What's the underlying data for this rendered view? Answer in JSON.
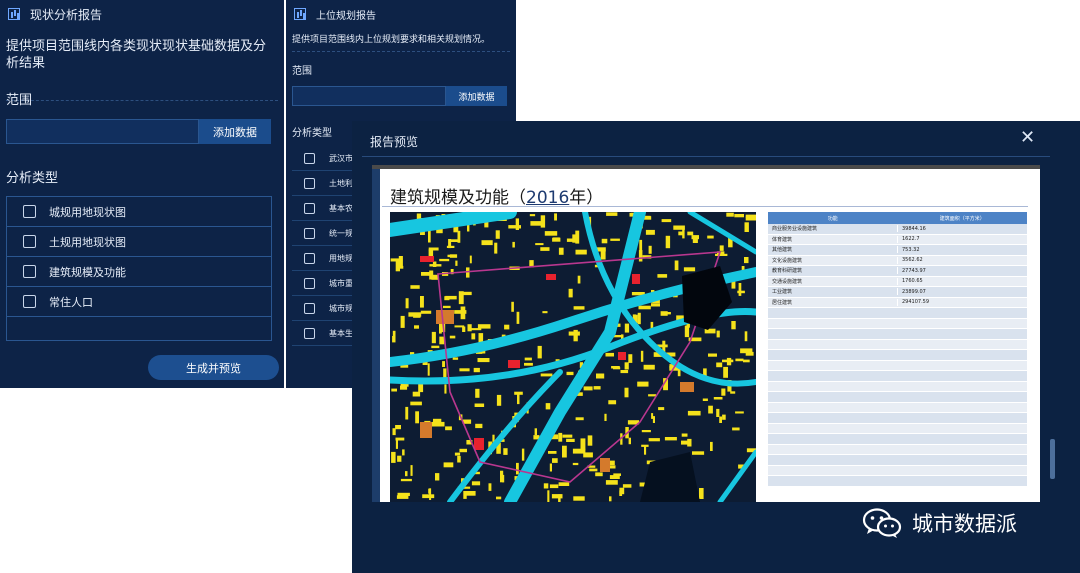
{
  "panel_a": {
    "title": "现状分析报告",
    "description": "提供项目范围线内各类现状现状基础数据及分析结果",
    "range_label": "范围",
    "add_data_label": "添加数据",
    "type_label": "分析类型",
    "types": [
      "城规用地现状图",
      "土规用地现状图",
      "建筑规模及功能",
      "常住人口"
    ],
    "generate_label": "生成并预览"
  },
  "panel_b": {
    "title": "上位规划报告",
    "description": "提供项目范围线内上位规划要求和相关规划情况。",
    "range_label": "范围",
    "add_data_label": "添加数据",
    "type_label": "分析类型",
    "types": [
      "武汉市",
      "土地利",
      "基本农",
      "统一规",
      "用地规",
      "城市重",
      "城市规",
      "基本生"
    ]
  },
  "modal": {
    "title": "报告预览",
    "close_icon": "close-icon",
    "doc_title_prefix": "建筑规模及功能（",
    "doc_title_year": "2016",
    "doc_title_suffix": "年）",
    "table": {
      "headers": [
        "功能",
        "建筑面积（平方米）"
      ],
      "rows": [
        [
          "商业服务业设施建筑",
          "39844.16"
        ],
        [
          "体育建筑",
          "1622.7"
        ],
        [
          "其他建筑",
          "753.32"
        ],
        [
          "文化设施建筑",
          "3562.62"
        ],
        [
          "教育科研建筑",
          "27743.97"
        ],
        [
          "交通设施建筑",
          "1760.65"
        ],
        [
          "工业建筑",
          "23899.07"
        ],
        [
          "居住建筑",
          "294107.59"
        ]
      ]
    }
  },
  "watermark": {
    "text": "城市数据派",
    "icon": "wechat-icon"
  },
  "colors": {
    "panel_bg": "#0d2347",
    "button_bg": "#1b4c8c",
    "table_header": "#4d83c6",
    "map_building": "#f5e21b",
    "map_road": "#17c6e0"
  }
}
